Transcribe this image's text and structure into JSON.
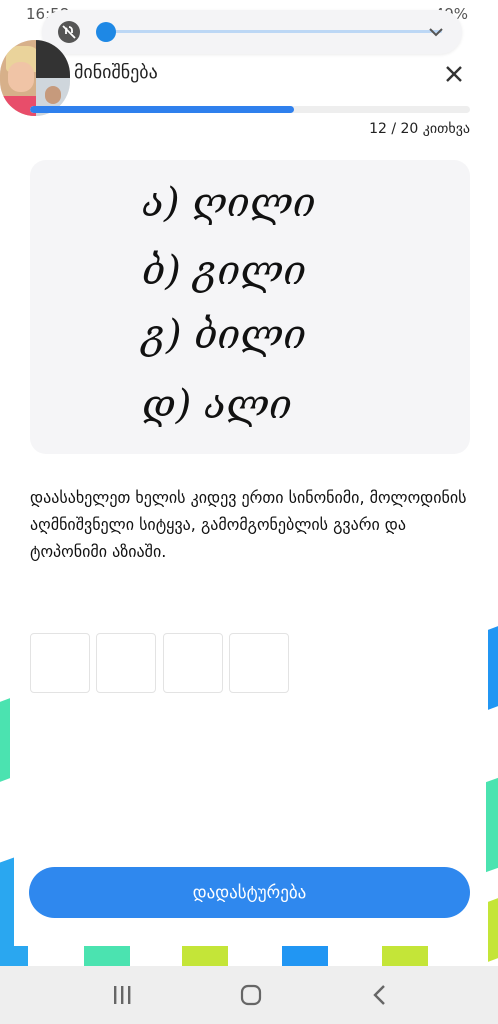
{
  "status_bar": {
    "time": "16:58",
    "battery": "49%"
  },
  "header": {
    "title": "მინიშნება",
    "progress_fraction": 0.6,
    "counter": "12 / 20 კითხვა"
  },
  "image": {
    "lines": [
      "ა)  ღილი",
      "ბ)  გილი",
      "გ)  ბილი",
      "დ)  ალი"
    ]
  },
  "prompt": "დაასახელეთ ხელის კიდევ ერთი სინონიმი, მოლოდინის აღმნიშვნელი სიტყვა, გამომგონებლის გვარი და ტოპონიმი აზიაში.",
  "answer": {
    "slots": [
      "",
      "",
      "",
      ""
    ]
  },
  "confirm_label": "დადასტურება",
  "colors": {
    "accent": "#2f88ee",
    "progress": "#2f80ed",
    "stripe_green": "#4be3b0",
    "stripe_blue": "#2196f3",
    "stripe_lime": "#c4e538"
  },
  "icons": {
    "mute": "mute-icon",
    "chevron": "chevron-down-icon",
    "close": "close-icon",
    "recents": "recents-icon",
    "home": "home-icon",
    "back": "back-icon"
  }
}
